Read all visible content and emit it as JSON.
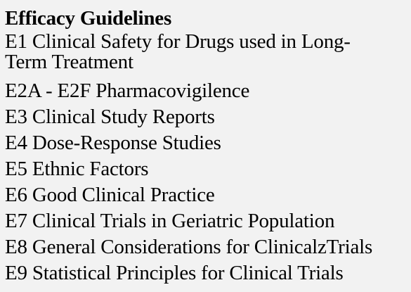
{
  "heading": "Efficacy Guidelines",
  "guidelines": [
    {
      "line1": "E1 Clinical Safety for Drugs used in Long-",
      "line2": "Term Treatment"
    },
    {
      "text": "E2A - E2F Pharmacovigilence"
    },
    {
      "text": "E3 Clinical Study Reports"
    },
    {
      "text": "E4 Dose-Response Studies"
    },
    {
      "text": "E5 Ethnic Factors"
    },
    {
      "text": "E6 Good Clinical Practice"
    },
    {
      "text": "E7 Clinical Trials in Geriatric Population"
    },
    {
      "text": "E8 General Considerations for ClinicalzTrials"
    },
    {
      "text": "E9 Statistical Principles for Clinical Trials"
    }
  ]
}
